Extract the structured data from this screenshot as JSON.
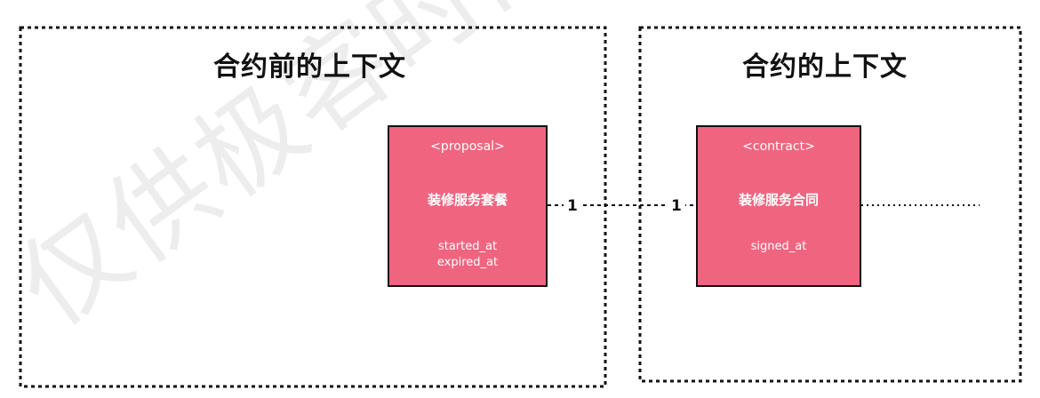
{
  "contexts": {
    "pre_contract": {
      "title": "合约前的上下文"
    },
    "contract": {
      "title": "合约的上下文"
    }
  },
  "entities": {
    "proposal": {
      "stereotype": "<proposal>",
      "name": "装修服务套餐",
      "attributes": [
        "started_at",
        "expired_at"
      ]
    },
    "contract": {
      "stereotype": "<contract>",
      "name": "装修服务合同",
      "attributes": [
        "signed_at"
      ]
    }
  },
  "relationship": {
    "left_multiplicity": "1",
    "right_multiplicity": "1"
  },
  "watermark": "仅供极客时间",
  "colors": {
    "entity_fill": "#ef6580",
    "border": "#111111",
    "background": "#ffffff"
  }
}
